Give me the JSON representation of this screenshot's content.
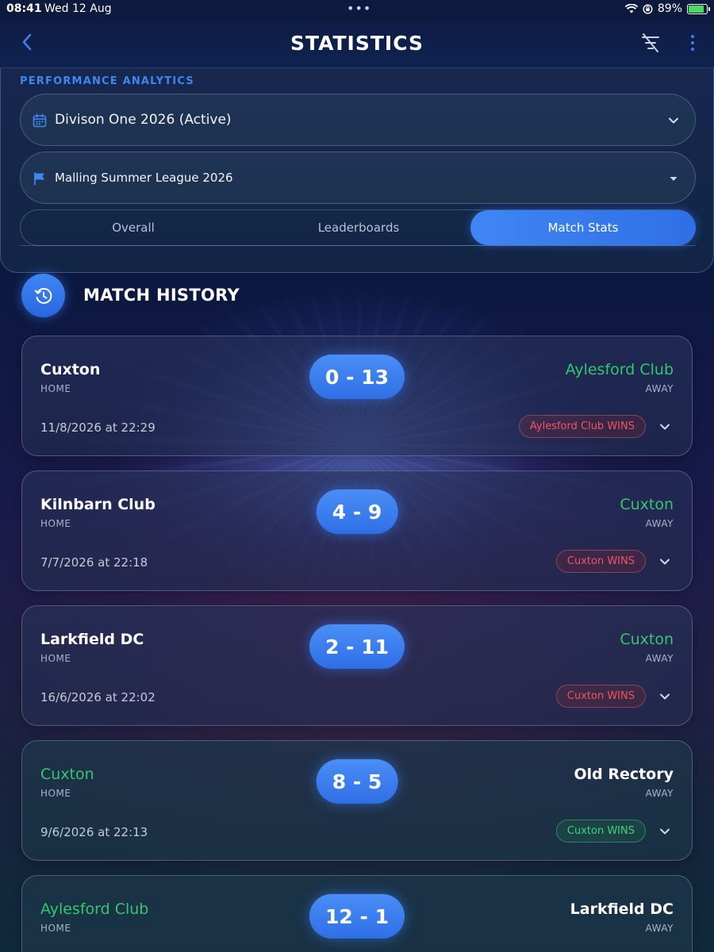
{
  "status_bar": {
    "time": "08:41",
    "date": "Wed 12 Aug",
    "battery": "89%",
    "battery_level": 0.89
  },
  "header": {
    "title": "STATISTICS",
    "icons": [
      "chevron-left-icon",
      "filter-off-icon",
      "more-vertical-icon"
    ]
  },
  "filters": {
    "section_label": "PERFORMANCE ANALYTICS",
    "season": "Divison One 2026 (Active)",
    "league": "Malling Summer League 2026",
    "tabs": [
      {
        "label": "Overall",
        "active": false
      },
      {
        "label": "Leaderboards",
        "active": false
      },
      {
        "label": "Match Stats",
        "active": true
      }
    ]
  },
  "history": {
    "title": "MATCH HISTORY",
    "home_label": "HOME",
    "away_label": "AWAY",
    "matches": [
      {
        "home": "Cuxton",
        "away": "Aylesford Club",
        "score": "0 - 13",
        "date": "11/8/2026 at 22:29",
        "result": "Aylesford Club WINS",
        "winner": "away",
        "outcome": "loss"
      },
      {
        "home": "Kilnbarn Club",
        "away": "Cuxton",
        "score": "4 - 9",
        "date": "7/7/2026 at 22:18",
        "result": "Cuxton WINS",
        "winner": "away",
        "outcome": "loss"
      },
      {
        "home": "Larkfield DC",
        "away": "Cuxton",
        "score": "2 - 11",
        "date": "16/6/2026 at 22:02",
        "result": "Cuxton WINS",
        "winner": "away",
        "outcome": "loss"
      },
      {
        "home": "Cuxton",
        "away": "Old Rectory",
        "score": "8 - 5",
        "date": "9/6/2026 at 22:13",
        "result": "Cuxton WINS",
        "winner": "home",
        "outcome": "win"
      },
      {
        "home": "Aylesford Club",
        "away": "Larkfield DC",
        "score": "12 - 1",
        "date": "",
        "result": "",
        "winner": "home",
        "outcome": "win"
      }
    ]
  },
  "colors": {
    "accent": "#3f86f4",
    "win_green": "#34c76b",
    "loss_red": "#f0555c",
    "background": "#0c1840"
  }
}
